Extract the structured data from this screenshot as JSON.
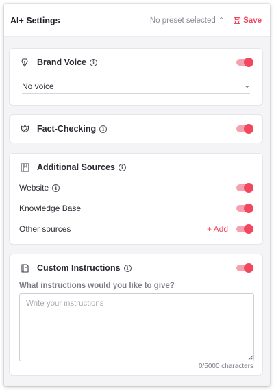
{
  "header": {
    "title": "AI+ Settings",
    "preset_label": "No preset selected",
    "save_label": "Save"
  },
  "brand_voice": {
    "title": "Brand Voice",
    "enabled": true,
    "selected_voice": "No voice"
  },
  "fact_checking": {
    "title": "Fact-Checking",
    "enabled": true
  },
  "additional_sources": {
    "title": "Additional Sources",
    "items": [
      {
        "label": "Website",
        "enabled": true
      },
      {
        "label": "Knowledge Base",
        "enabled": true
      },
      {
        "label": "Other sources",
        "enabled": true
      }
    ],
    "add_label": "+ Add"
  },
  "custom_instructions": {
    "title": "Custom Instructions",
    "enabled": true,
    "question": "What instructions would you like to give?",
    "placeholder": "Write your instructions",
    "counter": "0/5000 characters"
  },
  "colors": {
    "accent": "#f0485f",
    "toggle_track": "#f6a1ae"
  }
}
